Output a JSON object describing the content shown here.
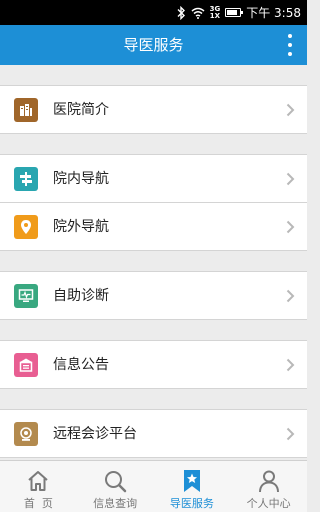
{
  "status_bar": {
    "network": "3G",
    "network_sub": "1X",
    "time": "下午 3:58"
  },
  "header": {
    "title": "导医服务"
  },
  "menu": {
    "items": [
      {
        "label": "医院简介",
        "icon": "hospital-building-icon",
        "color": "#a0662a"
      },
      {
        "label": "院内导航",
        "icon": "signpost-icon",
        "color": "#29a6b0"
      },
      {
        "label": "院外导航",
        "icon": "map-pin-icon",
        "color": "#f09b1a"
      },
      {
        "label": "自助诊断",
        "icon": "monitor-diagnosis-icon",
        "color": "#39a880"
      },
      {
        "label": "信息公告",
        "icon": "bulletin-icon",
        "color": "#e85e92"
      },
      {
        "label": "远程会诊平台",
        "icon": "webcam-icon",
        "color": "#b38a4e"
      }
    ]
  },
  "bottom_nav": {
    "items": [
      {
        "label": "首  页",
        "icon": "home-icon"
      },
      {
        "label": "信息查询",
        "icon": "search-icon"
      },
      {
        "label": "导医服务",
        "icon": "bookmark-star-icon",
        "active": true
      },
      {
        "label": "个人中心",
        "icon": "person-icon"
      }
    ]
  },
  "colors": {
    "accent": "#1d8fd6",
    "background": "#ececec"
  }
}
